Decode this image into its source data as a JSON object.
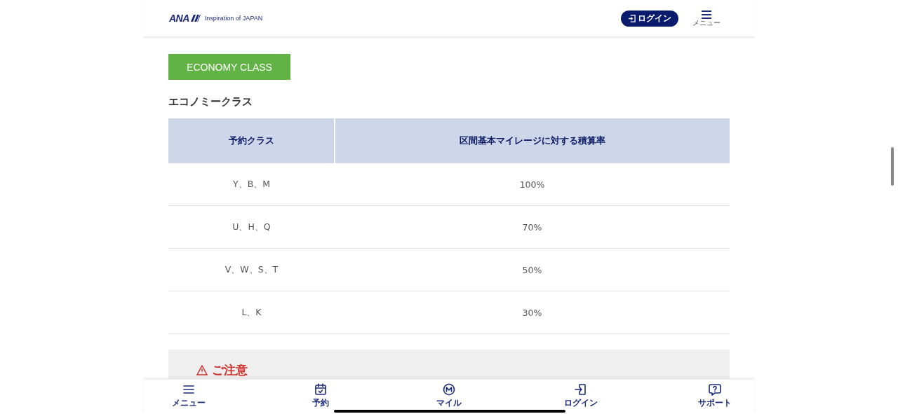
{
  "header": {
    "logo": "ANA",
    "tagline": "Inspiration of JAPAN",
    "login_button": "ログイン",
    "menu_label": "メニュー"
  },
  "class_badge": "ECONOMY CLASS",
  "section_title": "エコノミークラス",
  "table": {
    "columns": [
      "予約クラス",
      "区間基本マイレージに対する積算率"
    ],
    "rows": [
      [
        "Y、B、M",
        "100%"
      ],
      [
        "U、H、Q",
        "70%"
      ],
      [
        "V、W、S、T",
        "50%"
      ],
      [
        "L、K",
        "30%"
      ]
    ]
  },
  "notice": {
    "title": "ご注意"
  },
  "bottom_nav": [
    {
      "kind": "menu",
      "label": "メニュー"
    },
    {
      "kind": "calendar",
      "label": "予約"
    },
    {
      "kind": "mile",
      "label": "マイル"
    },
    {
      "kind": "login",
      "label": "ログイン"
    },
    {
      "kind": "help",
      "label": "サポート"
    }
  ]
}
